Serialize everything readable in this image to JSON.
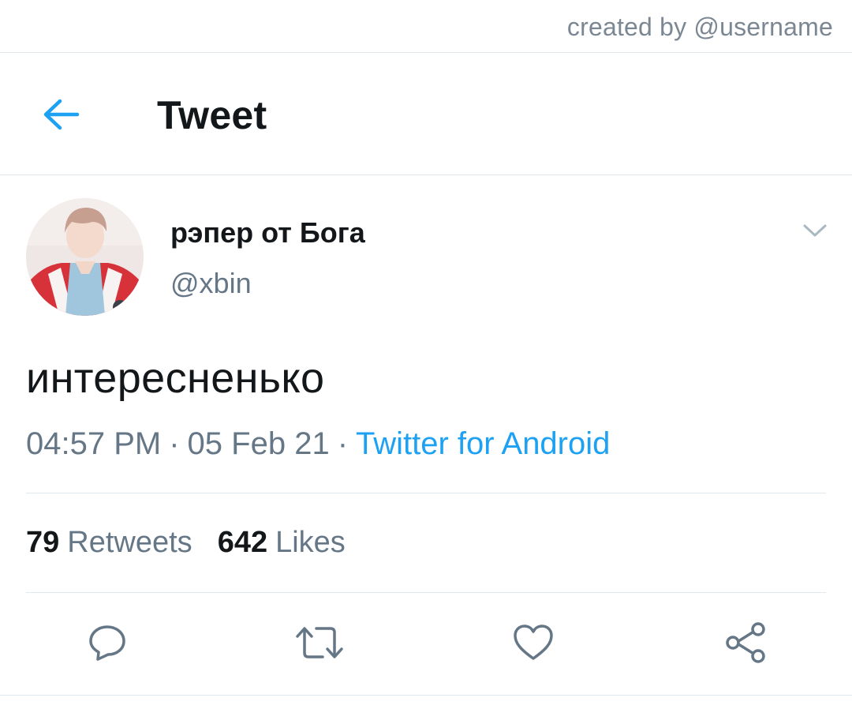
{
  "watermark": {
    "credit": "created by @username"
  },
  "header": {
    "title": "Tweet",
    "back_icon": "arrow-left-icon"
  },
  "tweet": {
    "author": {
      "display_name": "рэпер от Бога",
      "handle": "@xbin",
      "avatar": "avatar-photo"
    },
    "text": "интересненько",
    "time": "04:57 PM",
    "date": "05 Feb 21",
    "separator": "·",
    "source": "Twitter for Android",
    "stats": {
      "retweets_count": "79",
      "retweets_label": "Retweets",
      "likes_count": "642",
      "likes_label": "Likes"
    },
    "actions": [
      "reply-icon",
      "retweet-icon",
      "like-icon",
      "share-icon"
    ]
  },
  "colors": {
    "accent": "#1da1f2",
    "text_primary": "#14171a",
    "text_secondary": "#657786",
    "divider": "#e1e8ed"
  }
}
